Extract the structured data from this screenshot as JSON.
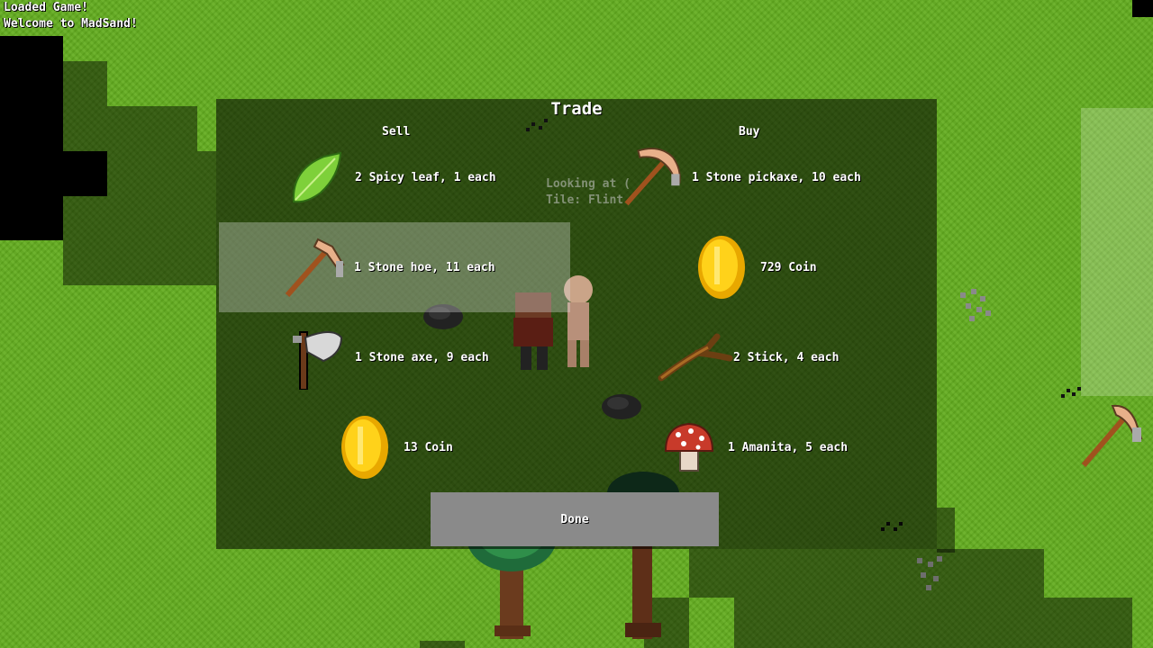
{
  "log": [
    "Loaded Game!",
    "Welcome to MadSand!"
  ],
  "trade": {
    "title": "Trade",
    "sell_header": "Sell",
    "buy_header": "Buy",
    "hover_info": [
      "Looking at (",
      "Tile: Flint"
    ],
    "sell": [
      {
        "label": "2 Spicy leaf, 1 each",
        "icon": "leaf-icon"
      },
      {
        "label": "1 Stone hoe, 11 each",
        "icon": "hoe-icon"
      },
      {
        "label": "1 Stone axe, 9 each",
        "icon": "axe-icon"
      },
      {
        "label": "13 Coin",
        "icon": "coin-icon"
      }
    ],
    "buy": [
      {
        "label": "1 Stone pickaxe, 10 each",
        "icon": "pickaxe-icon"
      },
      {
        "label": "729 Coin",
        "icon": "coin-icon"
      },
      {
        "label": "2 Stick, 4 each",
        "icon": "stick-icon"
      },
      {
        "label": "1 Amanita, 5 each",
        "icon": "mushroom-icon"
      }
    ],
    "done_label": "Done"
  }
}
